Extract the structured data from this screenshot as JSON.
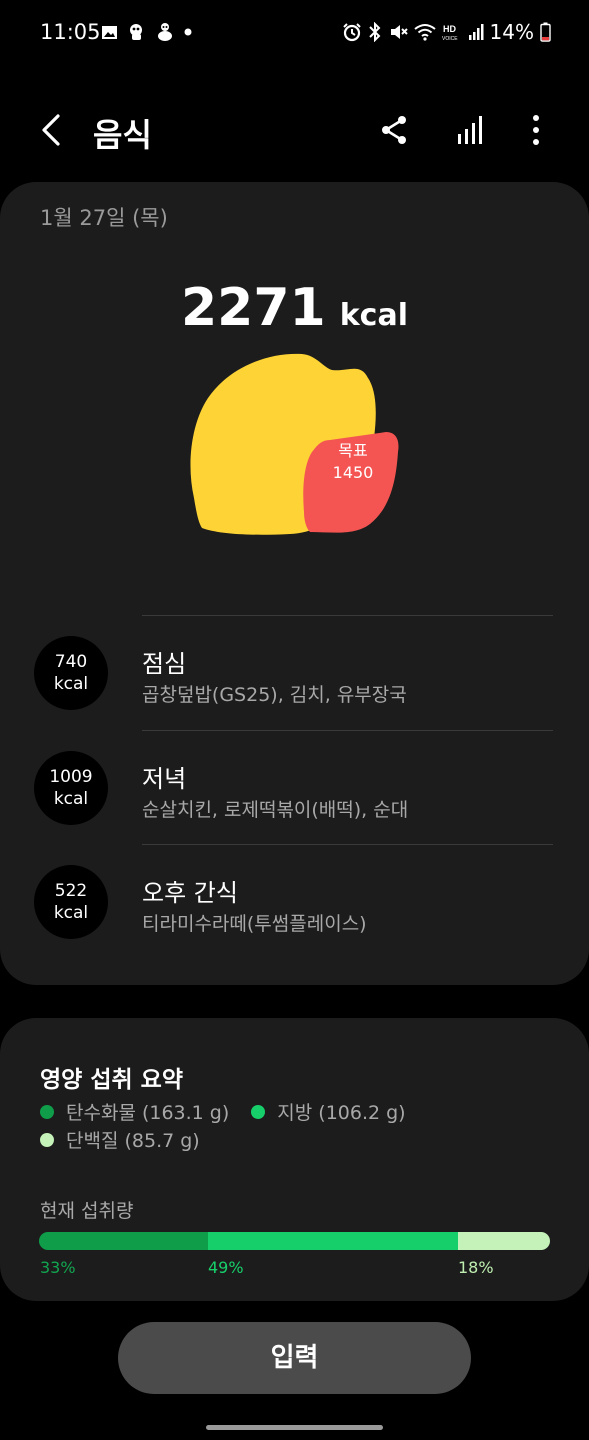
{
  "status": {
    "time": "11:05",
    "battery": "14%"
  },
  "app": {
    "title": "음식"
  },
  "summary": {
    "date": "1월 27일 (목)",
    "total_kcal": "2271",
    "kcal_unit": "kcal",
    "goal_label": "목표",
    "goal_value": "1450"
  },
  "meals": [
    {
      "kcal": "740",
      "unit": "kcal",
      "name": "점심",
      "items": "곱창덮밥(GS25), 김치, 유부장국"
    },
    {
      "kcal": "1009",
      "unit": "kcal",
      "name": "저녁",
      "items": "순살치킨, 로제떡볶이(배떡), 순대"
    },
    {
      "kcal": "522",
      "unit": "kcal",
      "name": "오후 간식",
      "items": "티라미수라떼(투썸플레이스)"
    }
  ],
  "nutrition": {
    "title": "영양 섭취 요약",
    "legend": [
      {
        "label": "탄수화물 (163.1 g)",
        "color": "#0f9d4a"
      },
      {
        "label": "지방 (106.2 g)",
        "color": "#17cf6a"
      },
      {
        "label": "단백질 (85.7 g)",
        "color": "#c5f2b8"
      }
    ],
    "current_label": "현재 섭취량",
    "percent_labels": [
      "33%",
      "49%",
      "18%"
    ],
    "shares": [
      33,
      49,
      18
    ]
  },
  "action": {
    "input_label": "입력"
  }
}
